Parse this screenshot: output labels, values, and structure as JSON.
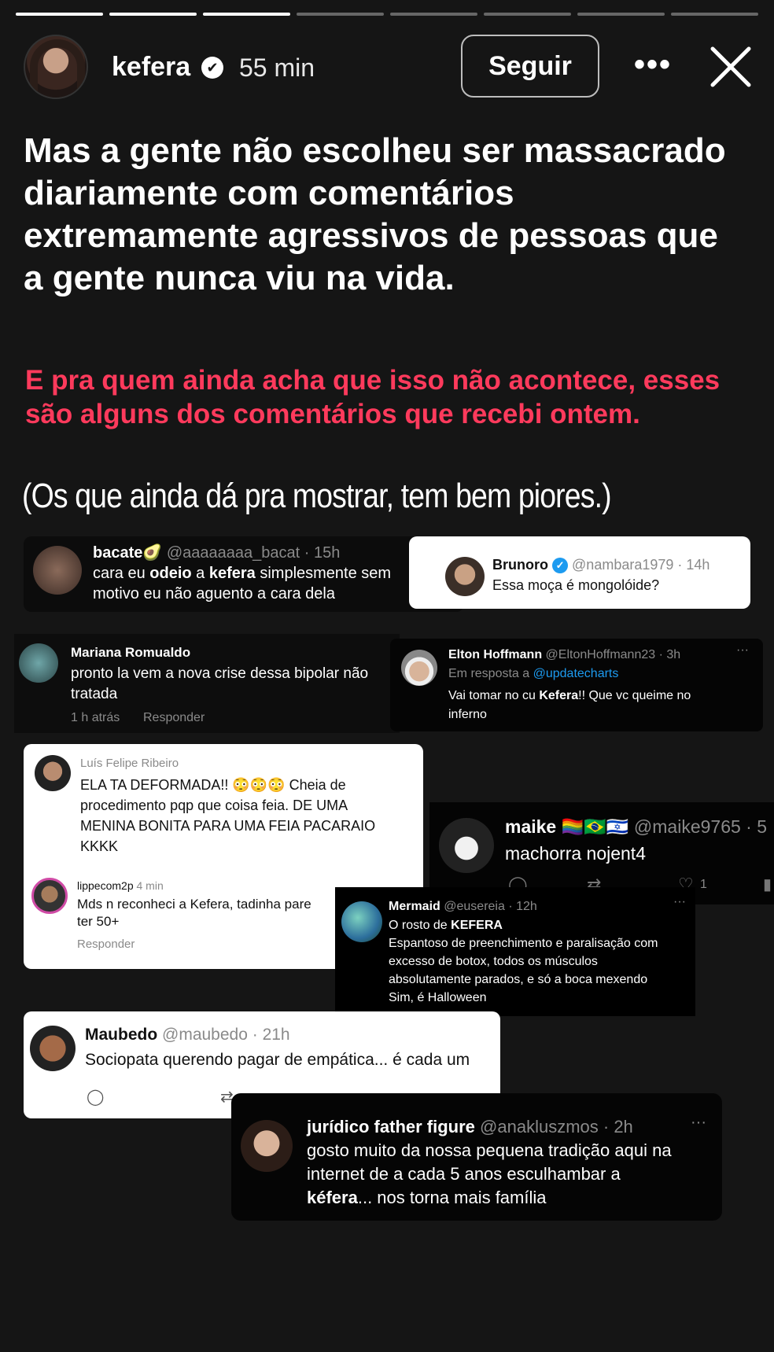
{
  "story": {
    "progress_total": 8,
    "progress_completed": 3,
    "username": "kefera",
    "verified_icon": "✔",
    "time": "55 min",
    "follow_label": "Seguir",
    "more_label": "•••"
  },
  "content": {
    "headline": "Mas a gente não escolheu ser massacrado diariamente com comentários extremamente agressivos de pessoas que a gente nunca viu na vida.",
    "red_text": "E pra quem ainda acha que isso não acontece, esses são alguns dos comentários que recebi ontem.",
    "note": "(Os que ainda dá pra mostrar, tem bem piores.)"
  },
  "comments": {
    "c1": {
      "name": "bacate🥑",
      "handle": "@aaaaaaaa_bacat · 15h",
      "line1_pre": "cara eu ",
      "line1_b1": "odeio",
      "line1_mid": " a ",
      "line1_b2": "kefera",
      "line1_post": " simplesmente sem",
      "line2": "motivo eu não aguento a cara dela"
    },
    "c2": {
      "name": "Brunoro",
      "handle": "@nambara1979 · 14h",
      "text": "Essa moça é mongolóide?"
    },
    "c3": {
      "name": "Mariana Romualdo",
      "line1": "pronto la vem a nova crise dessa bipolar não",
      "line2": "tratada",
      "time": "1 h atrás",
      "reply": "Responder"
    },
    "c4": {
      "name": "Elton Hoffmann",
      "handle": "@EltonHoffmann23 · 3h",
      "reply_pre": "Em resposta a ",
      "reply_to": "@updatecharts",
      "line1_pre": "Vai tomar no cu ",
      "line1_b": "Kefera",
      "line1_post": "!! Que vc queime no",
      "line2": "inferno",
      "more": "···"
    },
    "c5": {
      "name": "Luís Felipe Ribeiro",
      "line1": "ELA TA DEFORMADA!! 😳😳😳 Cheia de",
      "line2": "procedimento pqp que coisa feia. DE UMA",
      "line3": "MENINA BONITA PARA UMA FEIA PACARAIO",
      "line4": "KKKK"
    },
    "c6": {
      "name": "lippecom2p",
      "time": "4 min",
      "line1": "Mds n reconheci a Kefera, tadinha pare",
      "line2": "ter 50+",
      "reply": "Responder"
    },
    "c7": {
      "name": "maike 🏳️‍🌈🇧🇷🇮🇱",
      "handle": "@maike9765 · 5",
      "text": "machorra nojent4",
      "likes": "1"
    },
    "c8": {
      "name": "Mermaid",
      "handle": "@eusereia · 12h",
      "line1_pre": "O rosto de ",
      "line1_b": "KEFERA",
      "line2": "Espantoso de preenchimento e paralisação com",
      "line3": "excesso de botox, todos os músculos",
      "line4": "absolutamente parados, e só a boca mexendo",
      "line5": "Sim, é Halloween",
      "more": "···"
    },
    "c9": {
      "name": "Maubedo",
      "handle": "@maubedo · 21h",
      "text": "Sociopata querendo pagar de empática... é cada um"
    },
    "c10": {
      "name": "jurídico father figure",
      "handle": "@anakluszmos · 2h",
      "line1": "gosto muito da nossa pequena tradição aqui na",
      "line2": "internet de a cada 5 anos esculhambar a",
      "line3_b": "kéfera",
      "line3_post": "... nos torna mais família",
      "more": "···"
    }
  },
  "icons": {
    "reply": "◯",
    "retweet": "⇄",
    "like": "♡",
    "stats": "▮"
  },
  "colors": {
    "background": "#151515",
    "accent_red": "#ff3a5c",
    "twitter_blue": "#1d9bf0"
  }
}
